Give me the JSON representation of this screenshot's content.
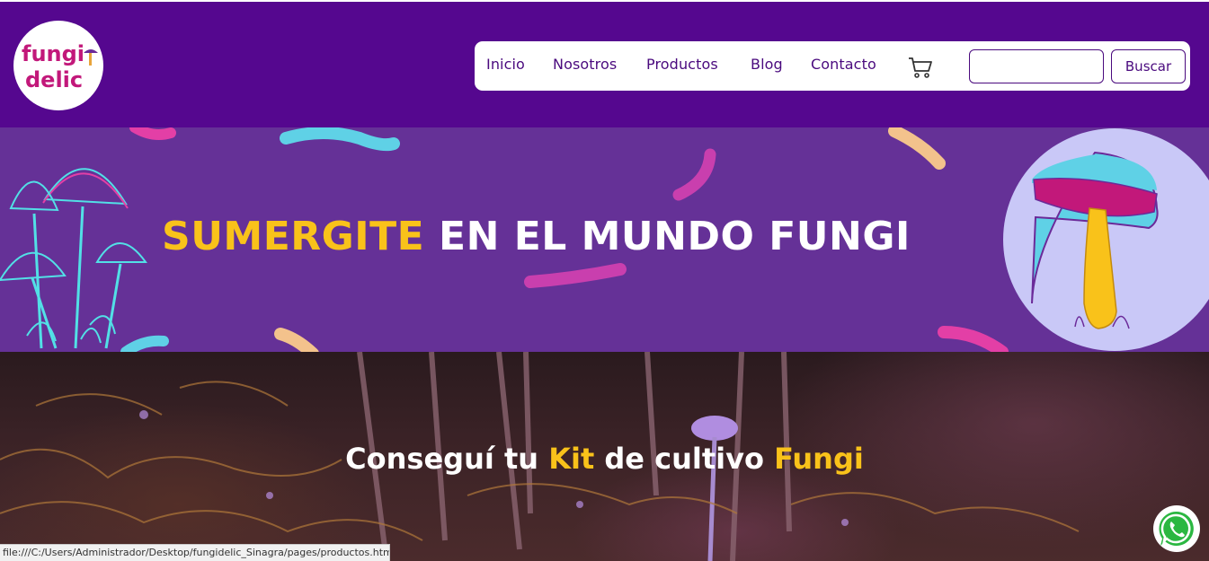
{
  "brand": {
    "logo_line1": "fungi",
    "logo_line2": "delic",
    "logo_colors": {
      "text": "#c2187a",
      "mushroom": "#6b2a99"
    }
  },
  "nav": {
    "items": [
      {
        "label": "Inicio"
      },
      {
        "label": "Nosotros"
      },
      {
        "label": "Productos"
      },
      {
        "label": "Blog"
      },
      {
        "label": "Contacto"
      }
    ],
    "cart_icon": "cart-icon",
    "search": {
      "value": "",
      "placeholder": "",
      "button_label": "Buscar"
    }
  },
  "banner": {
    "title_highlight": "SUMERGITE",
    "title_rest": " EN EL MUNDO FUNGI"
  },
  "hero": {
    "title_parts": [
      "Conseguí tu ",
      "Kit",
      " de cultivo ",
      "Fungi"
    ]
  },
  "whatsapp_icon": "whatsapp-icon",
  "status_bar": {
    "url": "file:///C:/Users/Administrador/Desktop/fungidelic_Sinagra/pages/productos.html"
  },
  "colors": {
    "header_bg": "#55078f",
    "nav_text": "#4a0a7e",
    "banner_bg": "#653197",
    "accent_yellow": "#f9c21a",
    "whatsapp_green": "#2bb741"
  }
}
